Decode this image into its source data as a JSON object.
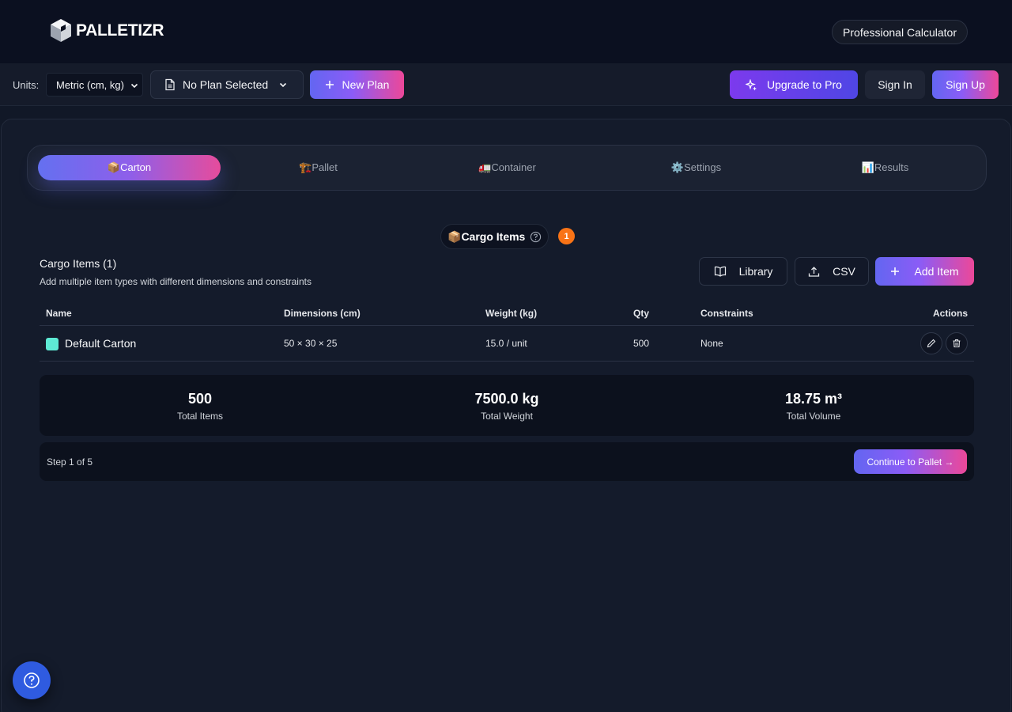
{
  "header": {
    "logo_text": "PALLETIZR",
    "pro_badge": "Professional Calculator"
  },
  "toolbar": {
    "units_label": "Units:",
    "units_value": "Metric (cm, kg)",
    "plan_value": "No Plan Selected",
    "new_plan": "New Plan",
    "upgrade": "Upgrade to Pro",
    "sign_in": "Sign In",
    "sign_up": "Sign Up"
  },
  "tabs": [
    {
      "label": "📦Carton",
      "active": true
    },
    {
      "label": "🏗️Pallet",
      "active": false
    },
    {
      "label": "🚛Container",
      "active": false
    },
    {
      "label": "⚙️Settings",
      "active": false
    },
    {
      "label": "📊Results",
      "active": false
    }
  ],
  "section": {
    "emoji": "📦",
    "title": "Cargo Items",
    "count": "1"
  },
  "cargo": {
    "title": "Cargo Items (1)",
    "subtitle": "Add multiple item types with different dimensions and constraints",
    "library": "Library",
    "csv": "CSV",
    "add_item": "Add Item"
  },
  "table": {
    "columns": [
      "Name",
      "Dimensions (cm)",
      "Weight (kg)",
      "Qty",
      "Constraints",
      "Actions"
    ],
    "rows": [
      {
        "color": "#5eead4",
        "name": "Default Carton",
        "dimensions": "50 × 30 × 25",
        "weight": "15.0 / unit",
        "qty": "500",
        "constraints": "None"
      }
    ]
  },
  "summary": {
    "total_items_value": "500",
    "total_items_label": "Total Items",
    "total_weight_value": "7500.0 kg",
    "total_weight_label": "Total Weight",
    "total_volume_value": "18.75 m³",
    "total_volume_label": "Total Volume"
  },
  "footer": {
    "step": "Step 1 of 5",
    "continue": "Continue to Pallet →"
  },
  "colors": {
    "accent_start": "#6366f1",
    "accent_end": "#ec4899",
    "badge": "#f97316",
    "help": "#2f5be0"
  }
}
